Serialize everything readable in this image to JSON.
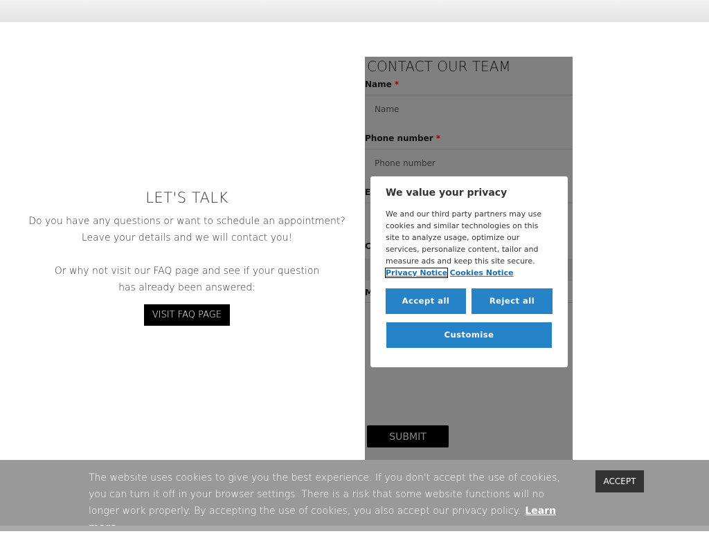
{
  "talk": {
    "title": "LET'S TALK",
    "line1": "Do you have any questions or want to schedule an appointment?",
    "line2": "Leave your details and we will contact you!",
    "line3": "Or why not visit our FAQ page and see if your question",
    "line4": "has already been answered:",
    "faq_button": "VISIT FAQ PAGE"
  },
  "form": {
    "title": "CONTACT OUR TEAM",
    "name_label": "Name",
    "name_placeholder": "Name",
    "phone_label": "Phone number",
    "phone_placeholder": "Phone number",
    "required": "*",
    "email_label_partial": "E",
    "country_label_partial": "C",
    "message_label_partial": "M",
    "submit": "SUBMIT"
  },
  "privacy": {
    "title": "We value your privacy",
    "body": "We and our third party partners may use cookies and similar technologies on this site to analyze usage, optimize our services, personalize content, tailor and measure ads and keep this site secure.",
    "privacy_link_a": "Privacy",
    "privacy_link_b": "Notice",
    "cookies_link": "Cookies Notice",
    "accept_all": "Accept all",
    "reject_all": "Reject all",
    "customise": "Customise",
    "accent": "#2783c8"
  },
  "banner": {
    "text": "The website uses cookies to give you the best experience. If you don't accept the use of cookies, you can turn it off in your browser settings. There is a risk that some website functions will no longer work properly. By accepting the use of cookies, you also accept our privacy policy.",
    "learn_more": "Learn more",
    "accept": "ACCEPT"
  }
}
